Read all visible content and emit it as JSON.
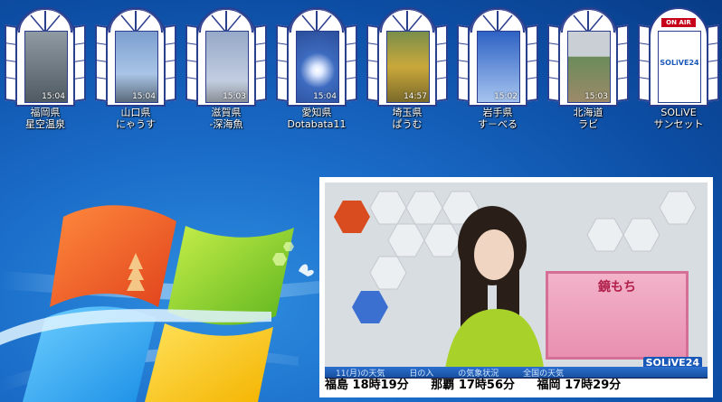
{
  "gadgets": [
    {
      "line1": "福岡県",
      "line2": "星空温泉",
      "time": "15:04",
      "sky": [
        "#8f9aa2",
        "#4f5a62"
      ]
    },
    {
      "line1": "山口県",
      "line2": "にゃうす",
      "time": "15:04",
      "sky": [
        "#a9c4e6",
        "#7c9fcf"
      ]
    },
    {
      "line1": "滋賀県",
      "line2": "-深海魚",
      "time": "15:03",
      "sky": [
        "#c2cde0",
        "#96a9c8"
      ]
    },
    {
      "line1": "愛知県",
      "line2": "Dotabata11",
      "time": "15:04",
      "sky": [
        "#3d6bbf",
        "#8fb0e0"
      ]
    },
    {
      "line1": "埼玉県",
      "line2": "ぱうむ",
      "time": "14:57",
      "sky": [
        "#c9a83b",
        "#7a6a2a"
      ]
    },
    {
      "line1": "岩手県",
      "line2": "す－べる",
      "time": "15:02",
      "sky": [
        "#3e73d1",
        "#a6c4ef"
      ]
    },
    {
      "line1": "北海道",
      "line2": "ラビ",
      "time": "15:03",
      "sky": [
        "#6b8b5a",
        "#9c8a6a"
      ]
    },
    {
      "line1": "SOLiVE",
      "line2": "サンセット",
      "time": "",
      "sky": [
        "#ffffff",
        "#ffffff"
      ],
      "badge": "ON AIR",
      "logo": "SOLiVE24"
    }
  ],
  "video": {
    "ticker_top": [
      "11(月)の天気",
      "日の入",
      "の気象状況",
      "全国の天気"
    ],
    "cities": [
      {
        "name": "福島",
        "time": "18時19分"
      },
      {
        "name": "那覇",
        "time": "17時56分"
      },
      {
        "name": "福岡",
        "time": "17時29分"
      }
    ],
    "brand": "SOLiVE24",
    "card_title": "鏡もち"
  },
  "colors": {
    "frame": "#2a3f8f",
    "desktop": "#1a6cc8"
  }
}
